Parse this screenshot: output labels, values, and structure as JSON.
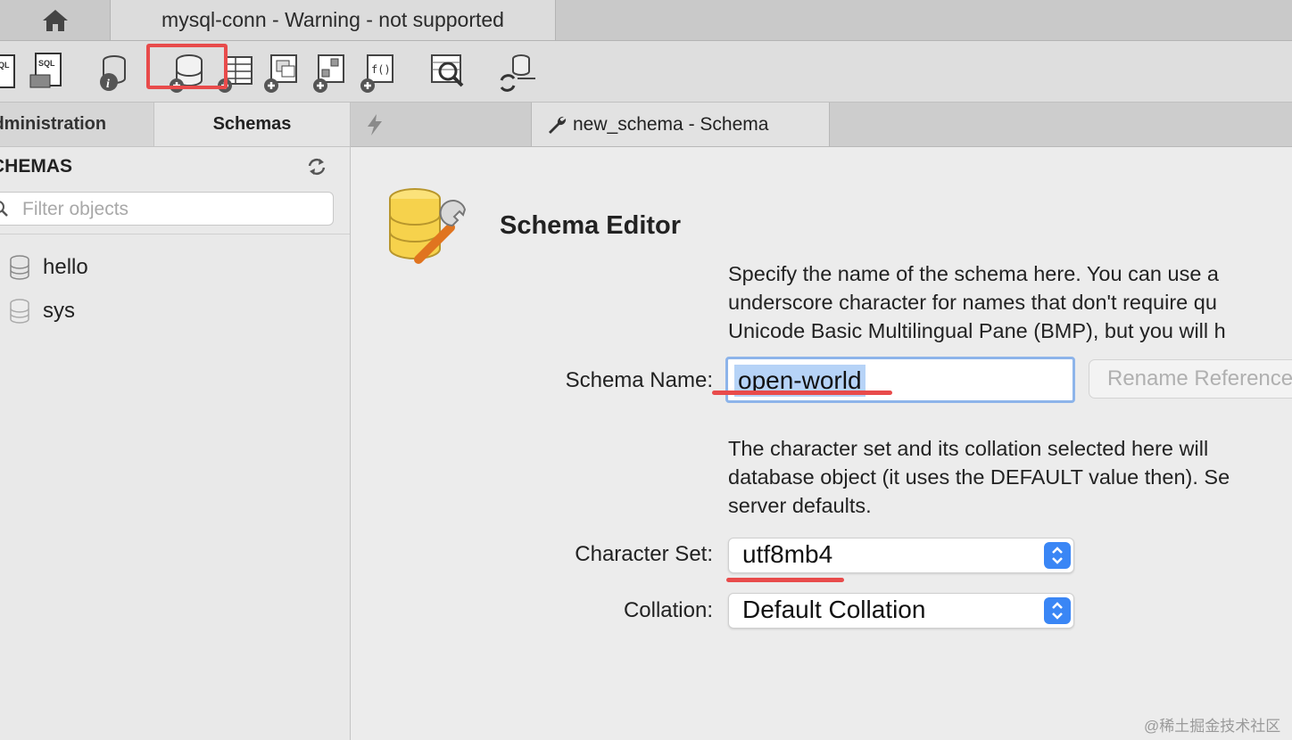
{
  "window": {
    "connection_tab": "mysql-conn - Warning - not supported"
  },
  "toolbar": {
    "icons": [
      "new-sql-tab-icon",
      "open-sql-script-icon",
      "inspector-icon",
      "create-schema-icon",
      "create-table-icon",
      "create-view-icon",
      "create-procedure-icon",
      "create-function-icon",
      "search-table-data-icon",
      "reconnect-icon"
    ],
    "highlighted": "create-schema-icon",
    "highlight_color": "#e84b4b"
  },
  "sidebar": {
    "tabs": {
      "administration": "Administration",
      "schemas": "Schemas"
    },
    "section_title": "SCHEMAS",
    "filter_placeholder": "Filter objects",
    "schemas": [
      "hello",
      "sys"
    ]
  },
  "editor_tabs": {
    "schema_tab": "new_schema - Schema"
  },
  "editor": {
    "title": "Schema Editor",
    "name_desc": [
      "Specify the name of the schema here. You can use a",
      "underscore character for names that don't require qu",
      "Unicode Basic Multilingual Pane (BMP), but you will h"
    ],
    "schema_name_label": "Schema Name:",
    "schema_name_value": "open-world",
    "rename_button": "Rename References",
    "charset_desc": [
      "The character set and its collation selected here will",
      "database object (it uses the DEFAULT value then). Se",
      "server defaults."
    ],
    "character_set_label": "Character Set:",
    "character_set_value": "utf8mb4",
    "collation_label": "Collation:",
    "collation_value": "Default Collation"
  },
  "watermark": "@稀土掘金技术社区",
  "colors": {
    "accent": "#3a86f5",
    "annotation": "#e84b4b",
    "selection": "#b6d3f7"
  }
}
